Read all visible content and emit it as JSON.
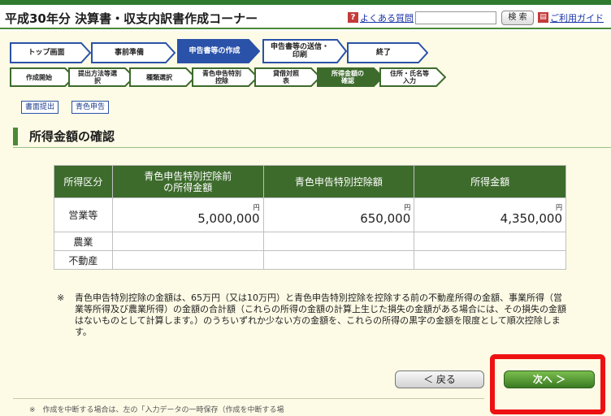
{
  "header": {
    "title": "平成30年分 決算書・収支内訳書作成コーナー",
    "faq_label": "よくある質問",
    "search_value": "",
    "search_button": "検 索",
    "guide_label": "ご利用ガイド"
  },
  "steps": [
    "トップ画面",
    "事前準備",
    "申告書等の作成",
    "申告書等の送信・印刷",
    "終了"
  ],
  "substeps": [
    "作成開始",
    "提出方法等選択",
    "種類選択",
    "青色申告特別控除",
    "貸借対照表",
    "所得金額の確認",
    "住所・氏名等入力"
  ],
  "chips": [
    "書面提出",
    "青色申告"
  ],
  "section_title": "所得金額の確認",
  "table": {
    "headers": [
      "所得区分",
      "青色申告特別控除前の所得金額",
      "青色申告特別控除額",
      "所得金額"
    ],
    "unit": "円",
    "rows": [
      {
        "label": "営業等",
        "before": "5,000,000",
        "deduction": "650,000",
        "income": "4,350,000"
      },
      {
        "label": "農業",
        "before": "",
        "deduction": "",
        "income": ""
      },
      {
        "label": "不動産",
        "before": "",
        "deduction": "",
        "income": ""
      }
    ]
  },
  "note": {
    "mark": "※",
    "text": "青色申告特別控除の金額は、65万円（又は10万円）と青色申告特別控除を控除する前の不動産所得の金額、事業所得（営業等所得及び農業所得）の金額の合計額（これらの所得の金額の計算上生じた損失の金額がある場合には、その損失の金額はないものとして計算します。）のうちいずれか少ない方の金額を、これらの所得の黒字の金額を限度として順次控除します。"
  },
  "buttons": {
    "back": "＜ 戻る",
    "next": "次へ ＞"
  },
  "footer": {
    "text": "※　作成を中断する場合は、左の「入力データの一時保存（作成を中断する場"
  },
  "colors": {
    "accent_green": "#3d6b2c",
    "highlight": "#ee1111",
    "panel": "#fdfbe6",
    "link": "#1a33a8"
  }
}
